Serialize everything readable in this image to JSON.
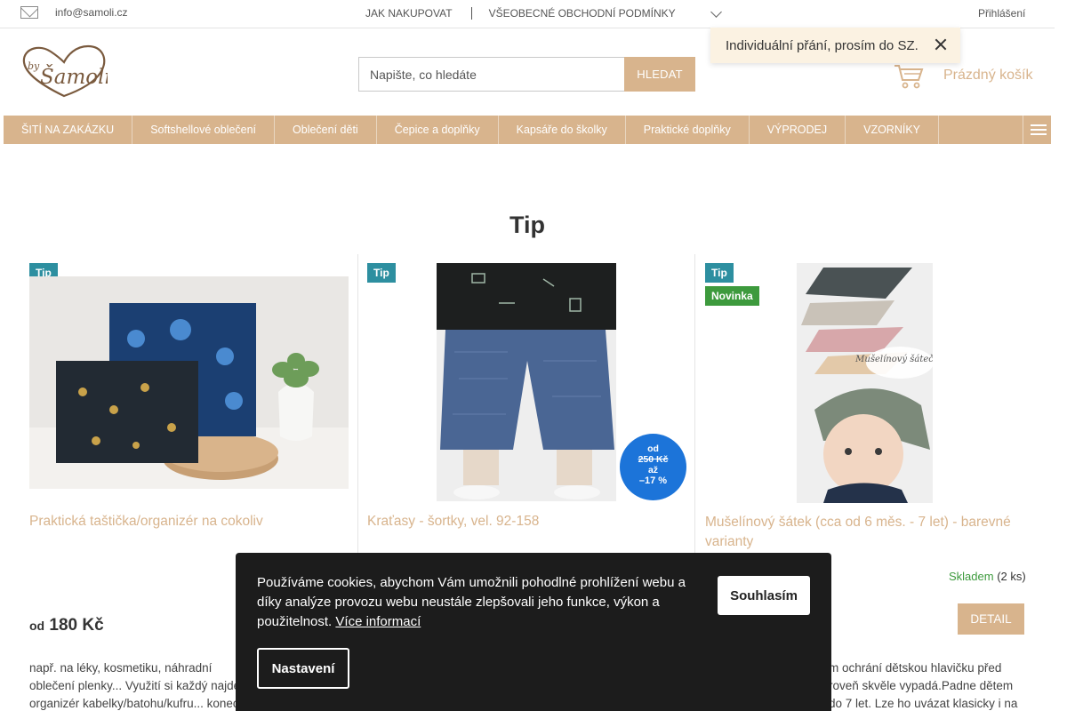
{
  "topbar": {
    "email": "info@samoli.cz",
    "links": [
      "JAK NAKUPOVAT",
      "VŠEOBECNÉ OBCHODNÍ PODMÍNKY"
    ],
    "login": "Přihlášení"
  },
  "header": {
    "logo_text": "by Šamoli",
    "search_placeholder": "Napište, co hledáte",
    "search_button": "HLEDAT",
    "cart_label": "Prázdný košík"
  },
  "toast": {
    "message": "Individuální přání, prosím do SZ."
  },
  "nav": {
    "items": [
      "ŠITÍ NA ZAKÁZKU",
      "Softshellové oblečení",
      "Oblečení děti",
      "Čepice a doplňky",
      "Kapsáře do školky",
      "Praktické doplňky",
      "VÝPRODEJ",
      "VZORNÍKY"
    ]
  },
  "section": {
    "title": "Tip"
  },
  "products": [
    {
      "flags": [
        "Tip"
      ],
      "name": "Praktická taštička/organizér na cokoliv",
      "price_prefix": "od",
      "price": "180 Kč",
      "description": "např. na léky, kosmetiku, náhradní oblečení plenky... Využití si každý najde organizér kabelky/batohu/kufru... konec hledání c"
    },
    {
      "flags": [
        "Tip"
      ],
      "name": "Kraťasy - šortky, vel. 92-158",
      "discount": {
        "from": "od",
        "old_price": "250 Kč",
        "to": "až",
        "percent": "–17 %"
      }
    },
    {
      "flags": [
        "Tip",
        "Novinka"
      ],
      "name": "Mušelínový šátek (cca od 6 měs. - 7 let) - barevné varianty",
      "stock_status": "Skladem",
      "stock_count": "(2 ks)",
      "detail_button": "DETAIL",
      "image_caption": "Mušelínový šáteček",
      "description": "m ochrání dětskou hlavičku před roveň skvěle vypadá.Padne dětem do 7 let. Lze ho uvázat klasicky i na"
    }
  ],
  "cookie": {
    "text": "Používáme cookies, abychom Vám umožnili pohodlné prohlížení webu a díky analýze provozu webu neustále zlepšovali jeho funkce, výkon a použitelnost.",
    "more_link": "Více informací",
    "accept": "Souhlasím",
    "settings": "Nastavení"
  },
  "colors": {
    "accent": "#d8b48d",
    "tip_flag": "#2d8fa0",
    "new_flag": "#3d9a3d",
    "discount": "#1c74d9",
    "cookie_bg": "#1c1c1c"
  }
}
